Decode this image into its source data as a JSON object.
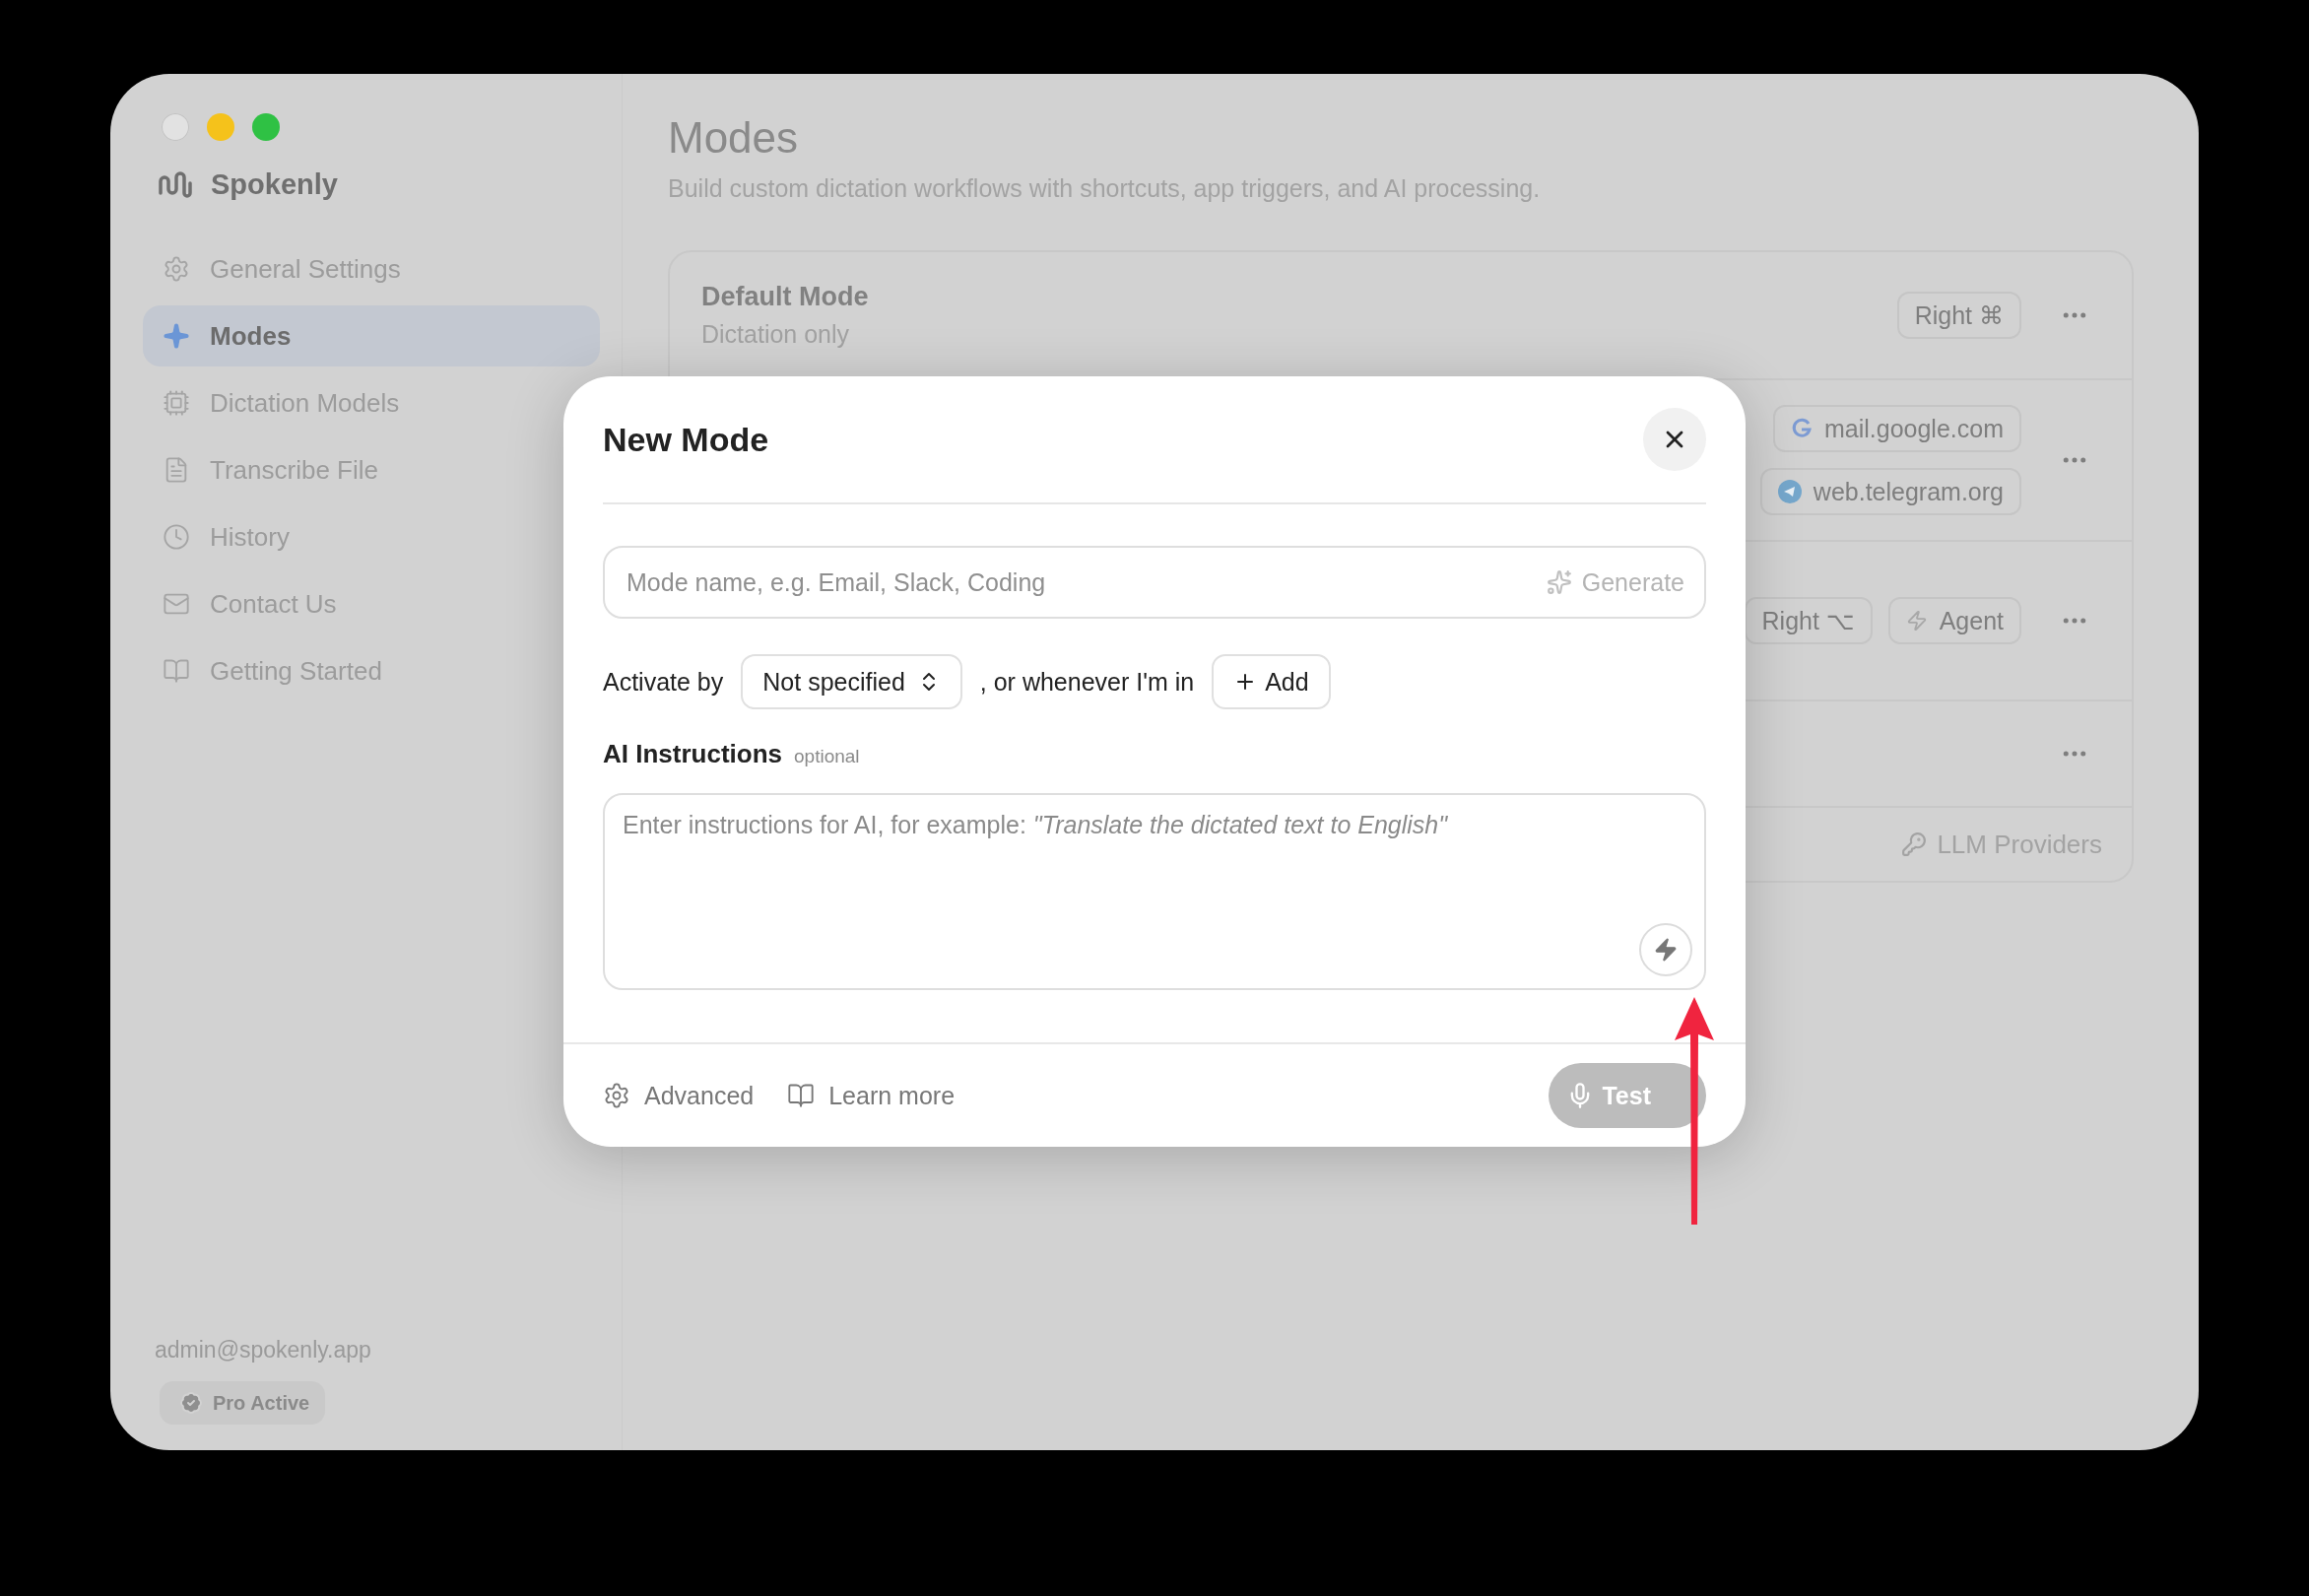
{
  "sidebar": {
    "app_name": "Spokenly",
    "items": [
      {
        "label": "General Settings",
        "selected": false
      },
      {
        "label": "Modes",
        "selected": true
      },
      {
        "label": "Dictation Models",
        "selected": false
      },
      {
        "label": "Transcribe File",
        "selected": false
      },
      {
        "label": "History",
        "selected": false
      },
      {
        "label": "Contact Us",
        "selected": false
      },
      {
        "label": "Getting Started",
        "selected": false
      }
    ],
    "account_email": "admin@spokenly.app",
    "plan_badge": "Pro Active"
  },
  "page": {
    "title": "Modes",
    "subtitle": "Build custom dictation workflows with shortcuts, app triggers, and AI processing."
  },
  "modes": [
    {
      "kind": "mode",
      "name": "Default Mode",
      "description": "Dictation only",
      "tags": [
        {
          "kind": "shortcut",
          "label": "Right ⌘"
        }
      ]
    },
    {
      "kind": "mode",
      "tags": [
        {
          "kind": "site",
          "label": "mail.google.com"
        },
        {
          "kind": "site",
          "label": "web.telegram.org"
        }
      ]
    },
    {
      "kind": "mode",
      "tags": [
        {
          "kind": "shortcut",
          "label": "Right ⌥"
        },
        {
          "kind": "agent",
          "label": "Agent"
        }
      ]
    },
    {
      "kind": "mode"
    }
  ],
  "footer_link": "LLM Providers",
  "dialog": {
    "title": "New Mode",
    "name_field": {
      "placeholder": "Mode name, e.g. Email, Slack, Coding",
      "generate_label": "Generate"
    },
    "activate_label": "Activate by",
    "activate_select": "Not specified",
    "connector": ", or whenever I'm in",
    "add_label": "Add",
    "instructions_label": "AI Instructions",
    "optional_tag": "optional",
    "instructions_placeholder": "Enter instructions for AI, for example: *\"Translate the dictated text to English\"*",
    "footer": {
      "advanced": "Advanced",
      "learn_more": "Learn more",
      "test": {
        "label": "Test",
        "disabled": true
      }
    }
  }
}
